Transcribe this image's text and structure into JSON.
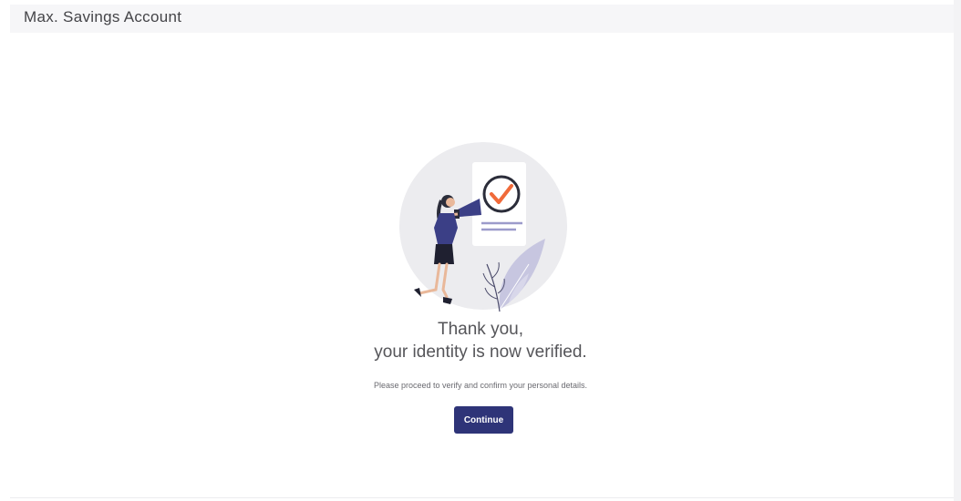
{
  "header": {
    "title": "Max. Savings Account"
  },
  "main": {
    "illustration_icon": "identity-verified-illustration",
    "heading_line1": "Thank you,",
    "heading_line2": "your identity is now verified.",
    "subtext": "Please proceed to verify and confirm your personal details.",
    "continue_label": "Continue"
  },
  "colors": {
    "accent": "#2e3478",
    "check_orange": "#f06a3a",
    "figure_navy": "#3b3f86",
    "leaf_lavender": "#c7c6e0",
    "circle_bg": "#ececef"
  }
}
